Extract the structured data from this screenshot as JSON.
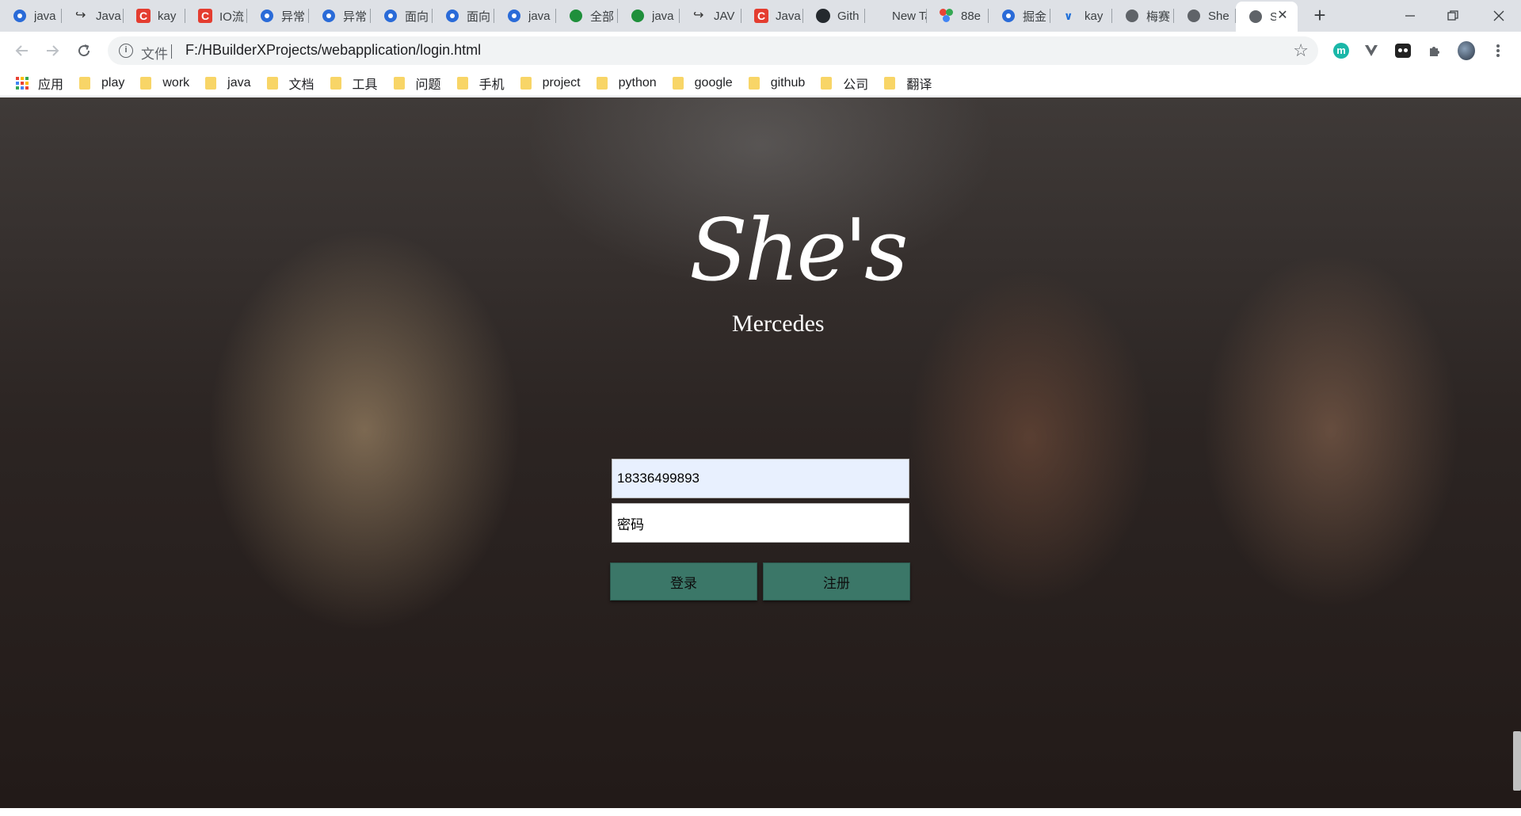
{
  "browser": {
    "tabs": [
      {
        "title": "java",
        "icon": "baidu-paw-icon"
      },
      {
        "title": "Java",
        "icon": "fish-icon"
      },
      {
        "title": "kay",
        "icon": "csdn-icon"
      },
      {
        "title": "IO流",
        "icon": "csdn-icon"
      },
      {
        "title": "异常",
        "icon": "baidu-paw-icon"
      },
      {
        "title": "异常",
        "icon": "baidu-paw-icon"
      },
      {
        "title": "面向",
        "icon": "baidu-paw-icon"
      },
      {
        "title": "面向",
        "icon": "baidu-paw-icon"
      },
      {
        "title": "java",
        "icon": "baidu-paw-icon"
      },
      {
        "title": "全部",
        "icon": "green-c-icon"
      },
      {
        "title": "java",
        "icon": "green-c-icon"
      },
      {
        "title": "JAV",
        "icon": "fish-icon"
      },
      {
        "title": "Java",
        "icon": "csdn-icon"
      },
      {
        "title": "Gith",
        "icon": "github-icon"
      },
      {
        "title": "New Ta",
        "icon": ""
      },
      {
        "title": "88e",
        "icon": "colorful-dots-icon"
      },
      {
        "title": "掘金",
        "icon": "baidu-paw-icon"
      },
      {
        "title": "kay",
        "icon": "blue-v-icon"
      },
      {
        "title": "梅赛",
        "icon": "globe-icon"
      },
      {
        "title": "She",
        "icon": "globe-icon"
      }
    ],
    "active_tab": {
      "title": "S",
      "icon": "globe-icon"
    },
    "address": {
      "scheme_label": "文件",
      "url": "F:/HBuilderXProjects/webapplication/login.html"
    },
    "bookmarks": {
      "apps_label": "应用",
      "folders": [
        "play",
        "work",
        "java",
        "文档",
        "工具",
        "问题",
        "手机",
        "project",
        "python",
        "google",
        "github",
        "公司",
        "翻译"
      ]
    }
  },
  "page": {
    "logo": {
      "script": "She's",
      "sub": "Mercedes"
    },
    "username_value": "18336499893",
    "password_placeholder": "密码",
    "login_label": "登录",
    "register_label": "注册"
  },
  "colors": {
    "button_bg": "#3b7768",
    "tabstrip_bg": "#dee1e6",
    "autofill_bg": "#e8f0fe"
  }
}
